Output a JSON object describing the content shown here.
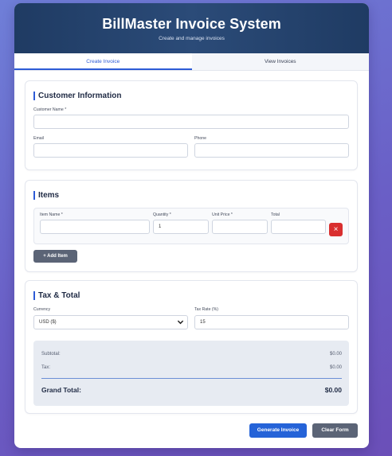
{
  "app": {
    "title": "BillMaster Invoice System",
    "subtitle": "Create and manage invoices"
  },
  "tabs": [
    {
      "label": "Create Invoice",
      "active": true
    },
    {
      "label": "View Invoices",
      "active": false
    }
  ],
  "customer": {
    "title": "Customer Information",
    "name_label": "Customer Name *",
    "name_value": "",
    "email_label": "Email",
    "email_value": "",
    "phone_label": "Phone",
    "phone_value": ""
  },
  "items": {
    "title": "Items",
    "col_name": "Item Name *",
    "col_qty": "Quantity *",
    "col_price": "Unit Price *",
    "col_total": "Total",
    "rows": [
      {
        "name": "",
        "quantity": "1",
        "unit_price": "",
        "total": ""
      }
    ],
    "delete_icon": "×",
    "add_label": "+ Add Item"
  },
  "tax": {
    "title": "Tax & Total",
    "currency_label": "Currency",
    "currency_value": "USD ($)",
    "tax_rate_label": "Tax Rate (%)",
    "tax_rate_value": "15",
    "subtotal_label": "Subtotal:",
    "subtotal_value": "$0.00",
    "tax_label": "Tax:",
    "tax_value": "$0.00",
    "grand_label": "Grand Total:",
    "grand_value": "$0.00"
  },
  "actions": {
    "generate_label": "Generate Invoice",
    "clear_label": "Clear Form"
  },
  "colors": {
    "accent": "#2563d8",
    "header": "#1f3b63",
    "danger": "#d92f2f",
    "secondary": "#5b6476"
  }
}
